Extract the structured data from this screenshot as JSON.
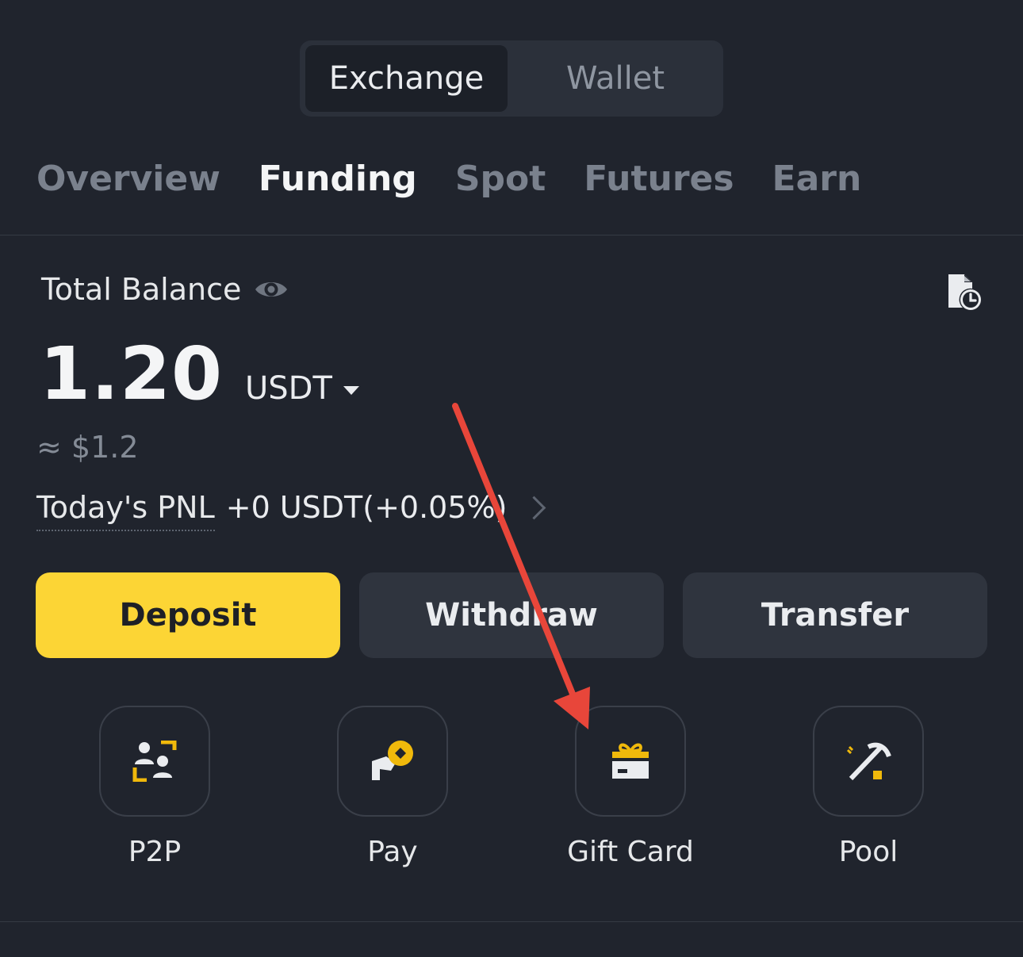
{
  "toggle": {
    "active": "Exchange",
    "inactive": "Wallet"
  },
  "tabs": [
    {
      "label": "Overview",
      "active": false
    },
    {
      "label": "Funding",
      "active": true
    },
    {
      "label": "Spot",
      "active": false
    },
    {
      "label": "Futures",
      "active": false
    },
    {
      "label": "Earn",
      "active": false
    }
  ],
  "balance": {
    "label": "Total Balance",
    "value": "1.20",
    "unit": "USDT",
    "approx": "≈ $1.2",
    "pnl_label": "Today's PNL",
    "pnl_value": "+0 USDT(+0.05%)"
  },
  "actions": {
    "deposit": "Deposit",
    "withdraw": "Withdraw",
    "transfer": "Transfer"
  },
  "shortcuts": [
    {
      "label": "P2P",
      "icon": "p2p-icon"
    },
    {
      "label": "Pay",
      "icon": "pay-icon"
    },
    {
      "label": "Gift Card",
      "icon": "gift-card-icon"
    },
    {
      "label": "Pool",
      "icon": "pool-icon"
    }
  ],
  "colors": {
    "background": "#20242d",
    "accent": "#fcd535",
    "annotation_arrow": "#e8463a"
  }
}
